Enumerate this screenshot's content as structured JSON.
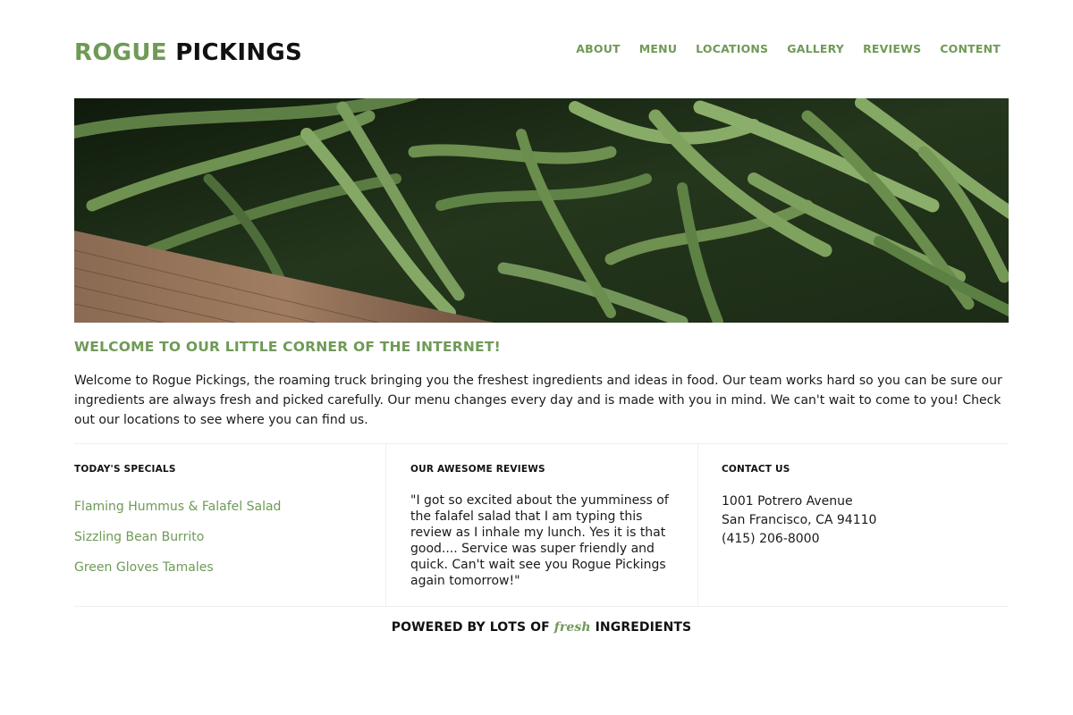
{
  "header": {
    "logo_first": "ROGUE",
    "logo_second": "PICKINGS",
    "nav": [
      "ABOUT",
      "MENU",
      "LOCATIONS",
      "GALLERY",
      "REVIEWS",
      "CONTENT"
    ]
  },
  "hero": {
    "image": "green-beans-photo"
  },
  "welcome": {
    "title": "WELCOME TO OUR LITTLE CORNER OF THE INTERNET!",
    "text": "Welcome to Rogue Pickings, the roaming truck bringing you the freshest ingredients and ideas in food. Our team works hard so you can be sure our ingredients are always fresh and picked carefully. Our menu changes every day and is made with you in mind. We can't wait to come to you! Check out our locations to see where you can find us."
  },
  "specials": {
    "title": "TODAY'S SPECIALS",
    "items": [
      "Flaming Hummus & Falafel Salad",
      "Sizzling Bean Burrito",
      "Green Gloves Tamales"
    ]
  },
  "reviews": {
    "title": "OUR AWESOME REVIEWS",
    "text": "\"I got so excited about the yumminess of the falafel salad that I am typing this review as I inhale my lunch. Yes it is that good.... Service was super friendly and quick. Can't wait see you Rogue Pickings again tomorrow!\""
  },
  "contact": {
    "title": "CONTACT US",
    "address1": "1001 Potrero Avenue",
    "address2": "San Francisco, CA 94110",
    "phone": "(415) 206-8000"
  },
  "footer": {
    "before": "POWERED BY LOTS OF",
    "fresh": "fresh",
    "after": "INGREDIENTS"
  },
  "colors": {
    "brand_green": "#6f9a57",
    "text_dark": "#1a1a1a"
  }
}
